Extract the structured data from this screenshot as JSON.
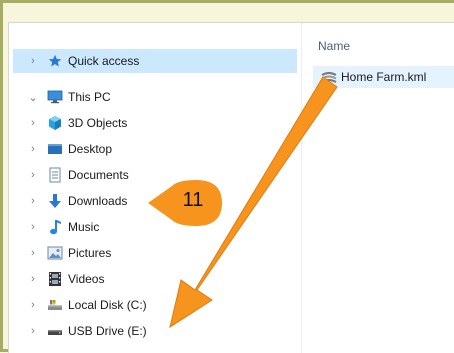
{
  "file_list": {
    "column_name": "Name",
    "files": [
      {
        "name": "Home Farm.kml",
        "icon": "kml-file-icon"
      }
    ]
  },
  "nav_tree": {
    "quick_access": {
      "label": "Quick access",
      "icon": "star-icon"
    },
    "this_pc": {
      "label": "This PC",
      "icon": "computer-icon"
    },
    "children": [
      {
        "label": "3D Objects",
        "icon": "cube-icon"
      },
      {
        "label": "Desktop",
        "icon": "desktop-icon"
      },
      {
        "label": "Documents",
        "icon": "document-icon"
      },
      {
        "label": "Downloads",
        "icon": "download-arrow-icon"
      },
      {
        "label": "Music",
        "icon": "music-note-icon"
      },
      {
        "label": "Pictures",
        "icon": "pictures-icon"
      },
      {
        "label": "Videos",
        "icon": "film-icon"
      },
      {
        "label": "Local Disk (C:)",
        "icon": "local-disk-icon"
      },
      {
        "label": "USB Drive (E:)",
        "icon": "usb-drive-icon"
      }
    ]
  },
  "annotation": {
    "step_number": "11"
  },
  "colors": {
    "accent_arrow": "#f7941d",
    "selection": "#cce8ff",
    "frame": "#a6ad62",
    "background": "#f7f5dc"
  }
}
